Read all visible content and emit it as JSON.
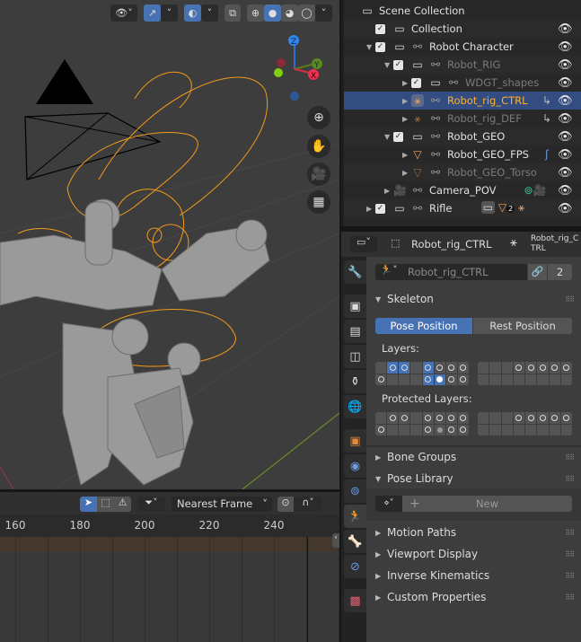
{
  "viewport": {
    "shading_modes": [
      "wireframe",
      "solid",
      "material",
      "rendered"
    ],
    "active_shading": "solid",
    "gizmo_axes": [
      "Z",
      "Y",
      "X"
    ],
    "nav_icons": [
      "zoom-icon",
      "hand-icon",
      "camera-icon",
      "grid-icon"
    ]
  },
  "timeline": {
    "snap_mode": "Nearest Frame",
    "ticks": [
      "160",
      "180",
      "200",
      "220",
      "240"
    ]
  },
  "outliner": {
    "rows": [
      {
        "label": "Scene Collection",
        "depth": 0,
        "type": "scene",
        "checked": null,
        "style": "normal",
        "eye": false,
        "arrow": ""
      },
      {
        "label": "Collection",
        "depth": 1,
        "type": "collection",
        "checked": true,
        "style": "normal",
        "eye": true,
        "arrow": ""
      },
      {
        "label": "Robot Character",
        "depth": 1,
        "type": "collection",
        "checked": true,
        "style": "normal",
        "eye": true,
        "arrow": "open",
        "link": true
      },
      {
        "label": "Robot_RIG",
        "depth": 2,
        "type": "collection",
        "checked": true,
        "style": "dim",
        "eye": true,
        "arrow": "open",
        "link": true
      },
      {
        "label": "WDGT_shapes",
        "depth": 3,
        "type": "collection",
        "checked": true,
        "style": "dim",
        "eye": true,
        "arrow": "closed",
        "link": true
      },
      {
        "label": "Robot_rig_CTRL",
        "depth": 3,
        "type": "armature",
        "checked": null,
        "style": "active",
        "eye": true,
        "arrow": "closed",
        "link": true,
        "extra": "constraint-icon"
      },
      {
        "label": "Robot_rig_DEF",
        "depth": 3,
        "type": "armature-dim",
        "checked": null,
        "style": "dim",
        "eye": true,
        "arrow": "closed",
        "link": true,
        "extra": "constraint-icon"
      },
      {
        "label": "Robot_GEO",
        "depth": 2,
        "type": "collection",
        "checked": true,
        "style": "normal",
        "eye": true,
        "arrow": "open",
        "link": true
      },
      {
        "label": "Robot_GEO_FPS",
        "depth": 3,
        "type": "mesh",
        "checked": null,
        "style": "normal",
        "eye": true,
        "arrow": "closed",
        "link": true,
        "extra": "hook-icon"
      },
      {
        "label": "Robot_GEO_Torso",
        "depth": 3,
        "type": "mesh-dim",
        "checked": null,
        "style": "dim",
        "eye": true,
        "arrow": "closed",
        "link": true
      },
      {
        "label": "Camera_POV",
        "depth": 2,
        "type": "camera",
        "checked": null,
        "style": "normal",
        "eye": true,
        "arrow": "closed",
        "link": true,
        "extra": "camera-data-icons"
      },
      {
        "label": "Rifle",
        "depth": 1,
        "type": "collection",
        "checked": true,
        "style": "normal",
        "eye": true,
        "arrow": "closed",
        "link": true,
        "extra": "rifle-children",
        "count": "2"
      }
    ]
  },
  "properties": {
    "breadcrumb": [
      "Robot_rig_CTRL",
      "Robot_rig_CTRL"
    ],
    "datablock_name": "Robot_rig_CTRL",
    "user_count": "2",
    "skeleton": {
      "title": "Skeleton",
      "pose_position": "Pose Position",
      "rest_position": "Rest Position",
      "active_position": "pose",
      "layers_label": "Layers:",
      "protected_label": "Protected Layers:",
      "layers": [
        [
          "e",
          "sc",
          "sc",
          "e",
          "sc",
          "c",
          "c",
          "c",
          "e",
          "e",
          "e",
          "c",
          "c",
          "c",
          "c",
          "c"
        ],
        [
          "c",
          "e",
          "e",
          "e",
          "sc",
          "sf",
          "c",
          "c",
          "e",
          "e",
          "e",
          "e",
          "e",
          "e",
          "e",
          "e"
        ]
      ],
      "protected": [
        [
          "e",
          "c",
          "c",
          "e",
          "c",
          "c",
          "c",
          "c",
          "e",
          "e",
          "e",
          "c",
          "c",
          "c",
          "c",
          "c"
        ],
        [
          "c",
          "e",
          "e",
          "e",
          "c",
          "g",
          "c",
          "c",
          "e",
          "e",
          "e",
          "e",
          "e",
          "e",
          "e",
          "e"
        ]
      ]
    },
    "panels": {
      "bone_groups": "Bone Groups",
      "pose_library": "Pose Library",
      "new_label": "New",
      "motion_paths": "Motion Paths",
      "viewport_display": "Viewport Display",
      "inverse_kinematics": "Inverse Kinematics",
      "custom_properties": "Custom Properties"
    }
  }
}
